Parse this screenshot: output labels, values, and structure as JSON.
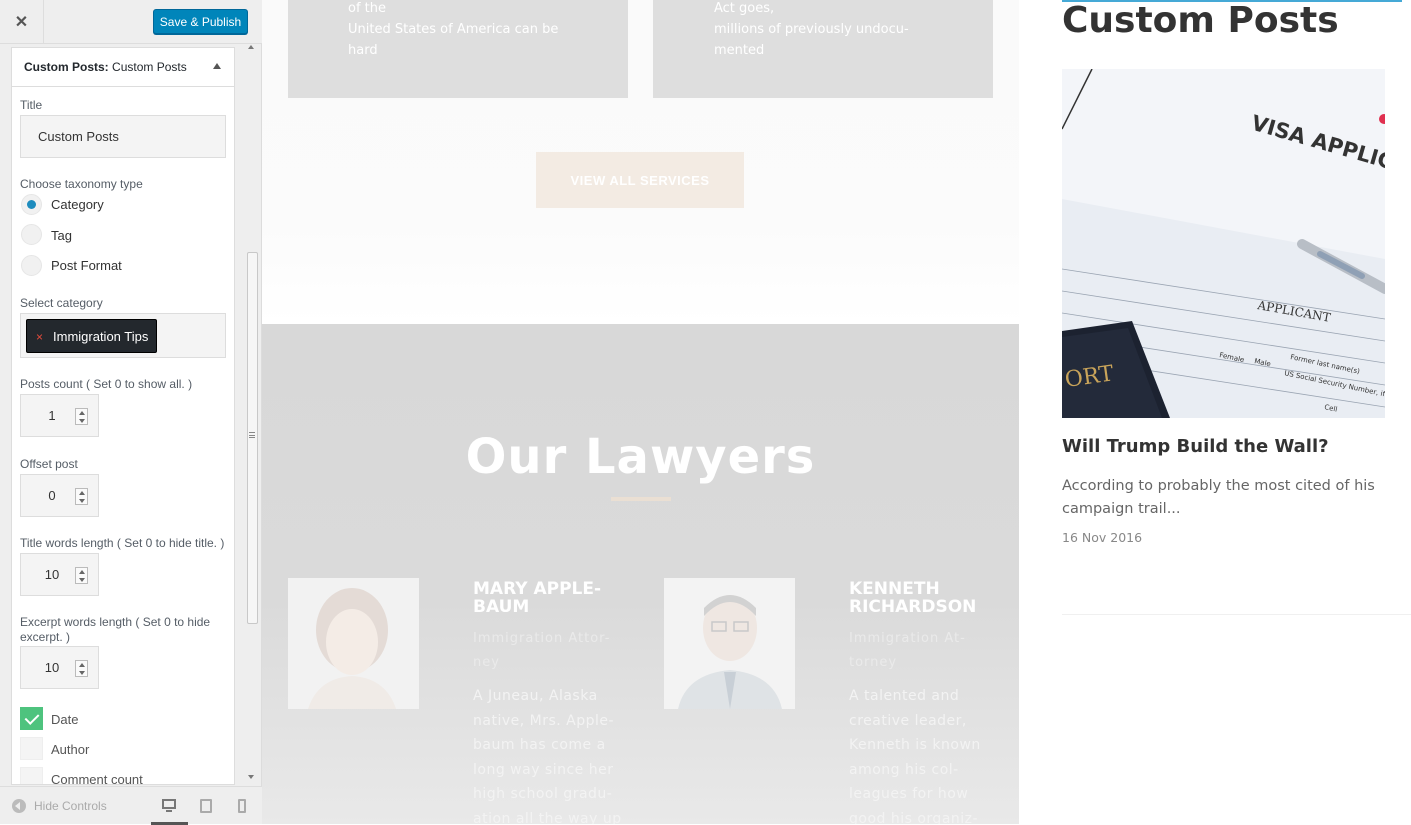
{
  "sidebar": {
    "close_label": "✕",
    "publish_label": "Save & Publish",
    "section_prefix": "Custom Posts:",
    "section_name": "Custom Posts",
    "title_label": "Title",
    "title_value": "Custom Posts",
    "taxonomy_label": "Choose taxonomy type",
    "taxonomy_options": [
      {
        "label": "Category",
        "selected": true
      },
      {
        "label": "Tag",
        "selected": false
      },
      {
        "label": "Post Format",
        "selected": false
      }
    ],
    "category_label": "Select category",
    "category_selected": "Immigration Tips",
    "chip_remove": "×",
    "posts_count_label": "Posts count ( Set 0 to show all. )",
    "posts_count_value": "1",
    "offset_label": "Offset post",
    "offset_value": "0",
    "title_words_label": "Title words length ( Set 0 to hide title. )",
    "title_words_value": "10",
    "excerpt_words_label": "Excerpt words length ( Set 0 to hide excerpt. )",
    "excerpt_words_value": "10",
    "checkboxes": [
      {
        "label": "Date",
        "checked": true
      },
      {
        "label": "Author",
        "checked": false
      },
      {
        "label": "Comment count",
        "checked": false
      }
    ],
    "hide_controls_label": "Hide Controls"
  },
  "preview": {
    "service_left_lines": [
      "of the",
      "United States of America can be",
      "hard"
    ],
    "service_right_lines": [
      "Act goes,",
      "millions of previously undocu-",
      "mented"
    ],
    "view_all_label": "VIEW ALL SERVICES",
    "lawyers_title": "Our Lawyers",
    "lawyers": [
      {
        "name_lines": [
          "MARY APPLE-",
          "BAUM"
        ],
        "role_lines": [
          "Immigration Attor-",
          "ney"
        ],
        "bio_lines": [
          "A Juneau, Alaska",
          "native, Mrs. Apple-",
          "baum has come a",
          "long way since her",
          "high school gradu-",
          "ation all the way up"
        ]
      },
      {
        "name_lines": [
          "KENNETH",
          "RICHARDSON"
        ],
        "role_lines": [
          "Immigration At-",
          "torney"
        ],
        "bio_lines": [
          "A talented and",
          "creative leader,",
          "Kenneth is known",
          "among his col-",
          "leagues for how",
          "good his organiz-"
        ]
      }
    ]
  },
  "widget": {
    "title": "Custom Posts",
    "post_title": "Will Trump Build the Wall?",
    "post_excerpt": "According to probably the most cited of his campaign trail...",
    "post_date": "16 Nov 2016",
    "image_text": {
      "visa": "VISA APPLIC",
      "applicant": "APPLICANT",
      "passport": "ORT",
      "female": "Female",
      "male": "Male",
      "former_last": "Former last name(s)",
      "ssn": "US Social Security Number, if any",
      "cell": "Cell"
    }
  },
  "colors": {
    "publish_blue": "#0085ba",
    "checkbox_green": "#4ec37e",
    "chip_bg": "#23282d",
    "lawyers_bg": "#d8d8d8",
    "accent_line": "#eadfd3"
  }
}
